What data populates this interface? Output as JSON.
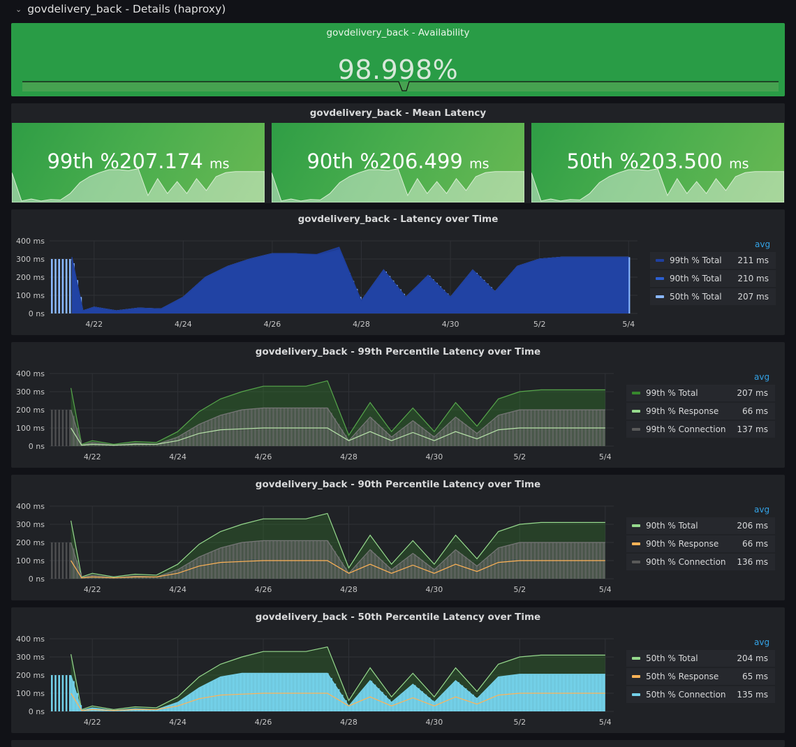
{
  "row": {
    "title": "govdelivery_back - Details (haproxy)"
  },
  "availability": {
    "title": "govdelivery_back - Availability",
    "value": "98.998%"
  },
  "mean_latency": {
    "title": "govdelivery_back - Mean Latency",
    "stats": [
      {
        "label": "99th %",
        "value": "207.174",
        "unit": "ms"
      },
      {
        "label": "90th %",
        "value": "206.499",
        "unit": "ms"
      },
      {
        "label": "50th %",
        "value": "203.500",
        "unit": "ms"
      }
    ]
  },
  "x_ticks": [
    "4/22",
    "4/24",
    "4/26",
    "4/28",
    "4/30",
    "5/2",
    "5/4"
  ],
  "y_ticks": [
    "400 ms",
    "300 ms",
    "200 ms",
    "100 ms",
    "0 ns"
  ],
  "legend_header": "avg",
  "panels": [
    {
      "title": "govdelivery_back - Latency over Time",
      "legend": [
        {
          "name": "99th % Total",
          "value": "211 ms",
          "color": "#1f3f9e"
        },
        {
          "name": "90th % Total",
          "value": "210 ms",
          "color": "#2c5fd1"
        },
        {
          "name": "50th % Total",
          "value": "207 ms",
          "color": "#8ab8ff"
        }
      ]
    },
    {
      "title": "govdelivery_back - 99th Percentile Latency over Time",
      "legend": [
        {
          "name": "99th % Total",
          "value": "207 ms",
          "color": "#37872d"
        },
        {
          "name": "99th % Response",
          "value": "66 ms",
          "color": "#96d98d"
        },
        {
          "name": "99th % Connection",
          "value": "137 ms",
          "color": "#5a5a5a"
        }
      ]
    },
    {
      "title": "govdelivery_back - 90th Percentile Latency over Time",
      "legend": [
        {
          "name": "90th % Total",
          "value": "206 ms",
          "color": "#96d98d"
        },
        {
          "name": "90th % Response",
          "value": "66 ms",
          "color": "#ffb357"
        },
        {
          "name": "90th % Connection",
          "value": "136 ms",
          "color": "#5a5a5a"
        }
      ]
    },
    {
      "title": "govdelivery_back - 50th Percentile Latency over Time",
      "legend": [
        {
          "name": "50th % Total",
          "value": "204 ms",
          "color": "#96d98d"
        },
        {
          "name": "50th % Response",
          "value": "65 ms",
          "color": "#ffb357"
        },
        {
          "name": "50th % Connection",
          "value": "135 ms",
          "color": "#73d0e8"
        }
      ]
    }
  ],
  "chart_data": [
    {
      "type": "area",
      "title": "govdelivery_back - Latency over Time",
      "x": [
        "4/21 12:00",
        "4/21 18:00",
        "4/22 00:00",
        "4/22 12:00",
        "4/23 00:00",
        "4/23 12:00",
        "4/24 00:00",
        "4/24 12:00",
        "4/25 00:00",
        "4/25 12:00",
        "4/26 00:00",
        "4/26 12:00",
        "4/27 00:00",
        "4/27 12:00",
        "4/28 00:00",
        "4/28 12:00",
        "4/29 00:00",
        "4/29 12:00",
        "4/30 00:00",
        "4/30 12:00",
        "5/1 00:00",
        "5/1 12:00",
        "5/2 00:00",
        "5/2 12:00",
        "5/3 00:00",
        "5/3 12:00",
        "5/4 00:00"
      ],
      "series": [
        {
          "name": "99th % Total",
          "values": [
            310,
            15,
            35,
            15,
            30,
            25,
            90,
            200,
            260,
            300,
            330,
            330,
            325,
            365,
            70,
            240,
            90,
            210,
            90,
            240,
            120,
            260,
            300,
            310,
            310,
            310,
            310
          ]
        },
        {
          "name": "90th % Total",
          "values": [
            310,
            15,
            35,
            15,
            30,
            25,
            90,
            200,
            260,
            300,
            330,
            330,
            320,
            350,
            70,
            240,
            90,
            210,
            90,
            240,
            120,
            260,
            300,
            310,
            310,
            310,
            310
          ]
        },
        {
          "name": "50th % Total",
          "values": [
            300,
            15,
            35,
            15,
            30,
            25,
            90,
            200,
            260,
            300,
            330,
            330,
            320,
            340,
            70,
            240,
            90,
            210,
            90,
            240,
            120,
            260,
            300,
            310,
            310,
            310,
            310
          ]
        }
      ],
      "xlim": [
        "4/21",
        "5/4"
      ],
      "ylim": [
        0,
        400
      ],
      "ylabel": ""
    },
    {
      "type": "area",
      "title": "govdelivery_back - 99th Percentile Latency over Time",
      "x": [
        "4/21 12:00",
        "4/21 18:00",
        "4/22 00:00",
        "4/22 12:00",
        "4/23 00:00",
        "4/23 12:00",
        "4/24 00:00",
        "4/24 12:00",
        "4/25 00:00",
        "4/25 12:00",
        "4/26 00:00",
        "4/26 12:00",
        "4/27 00:00",
        "4/27 12:00",
        "4/28 00:00",
        "4/28 12:00",
        "4/29 00:00",
        "4/29 12:00",
        "4/30 00:00",
        "4/30 12:00",
        "5/1 00:00",
        "5/1 12:00",
        "5/2 00:00",
        "5/2 12:00",
        "5/3 00:00",
        "5/3 12:00",
        "5/4 00:00"
      ],
      "series": [
        {
          "name": "99th % Total",
          "values": [
            320,
            10,
            30,
            10,
            25,
            20,
            80,
            190,
            260,
            300,
            330,
            330,
            330,
            360,
            60,
            240,
            80,
            210,
            80,
            240,
            110,
            260,
            300,
            310,
            310,
            310,
            310
          ]
        },
        {
          "name": "99th % Response",
          "values": [
            100,
            5,
            10,
            5,
            10,
            10,
            30,
            70,
            90,
            95,
            100,
            100,
            100,
            100,
            30,
            80,
            30,
            75,
            30,
            80,
            40,
            90,
            100,
            100,
            100,
            100,
            100
          ]
        },
        {
          "name": "99th % Connection",
          "values": [
            200,
            5,
            20,
            5,
            15,
            10,
            50,
            120,
            170,
            200,
            210,
            210,
            210,
            210,
            30,
            160,
            50,
            140,
            50,
            160,
            70,
            170,
            200,
            200,
            200,
            200,
            200
          ]
        }
      ],
      "xlim": [
        "4/21",
        "5/4"
      ],
      "ylim": [
        0,
        400
      ]
    },
    {
      "type": "area",
      "title": "govdelivery_back - 90th Percentile Latency over Time",
      "x": [
        "4/21 12:00",
        "4/21 18:00",
        "4/22 00:00",
        "4/22 12:00",
        "4/23 00:00",
        "4/23 12:00",
        "4/24 00:00",
        "4/24 12:00",
        "4/25 00:00",
        "4/25 12:00",
        "4/26 00:00",
        "4/26 12:00",
        "4/27 00:00",
        "4/27 12:00",
        "4/28 00:00",
        "4/28 12:00",
        "4/29 00:00",
        "4/29 12:00",
        "4/30 00:00",
        "4/30 12:00",
        "5/1 00:00",
        "5/1 12:00",
        "5/2 00:00",
        "5/2 12:00",
        "5/3 00:00",
        "5/3 12:00",
        "5/4 00:00"
      ],
      "series": [
        {
          "name": "90th % Total",
          "values": [
            320,
            10,
            30,
            10,
            25,
            20,
            80,
            190,
            260,
            300,
            330,
            330,
            330,
            360,
            60,
            240,
            80,
            210,
            80,
            240,
            110,
            260,
            300,
            310,
            310,
            310,
            310
          ]
        },
        {
          "name": "90th % Response",
          "values": [
            100,
            5,
            10,
            5,
            10,
            10,
            30,
            70,
            90,
            95,
            100,
            100,
            100,
            100,
            30,
            80,
            30,
            75,
            30,
            80,
            40,
            90,
            100,
            100,
            100,
            100,
            100
          ]
        },
        {
          "name": "90th % Connection",
          "values": [
            200,
            5,
            20,
            5,
            15,
            10,
            50,
            120,
            170,
            200,
            210,
            210,
            210,
            210,
            30,
            160,
            50,
            140,
            50,
            160,
            70,
            170,
            200,
            200,
            200,
            200,
            200
          ]
        }
      ],
      "xlim": [
        "4/21",
        "5/4"
      ],
      "ylim": [
        0,
        400
      ]
    },
    {
      "type": "area",
      "title": "govdelivery_back - 50th Percentile Latency over Time",
      "x": [
        "4/21 12:00",
        "4/21 18:00",
        "4/22 00:00",
        "4/22 12:00",
        "4/23 00:00",
        "4/23 12:00",
        "4/24 00:00",
        "4/24 12:00",
        "4/25 00:00",
        "4/25 12:00",
        "4/26 00:00",
        "4/26 12:00",
        "4/27 00:00",
        "4/27 12:00",
        "4/28 00:00",
        "4/28 12:00",
        "4/29 00:00",
        "4/29 12:00",
        "4/30 00:00",
        "4/30 12:00",
        "5/1 00:00",
        "5/1 12:00",
        "5/2 00:00",
        "5/2 12:00",
        "5/3 00:00",
        "5/3 12:00",
        "5/4 00:00"
      ],
      "series": [
        {
          "name": "50th % Total",
          "values": [
            315,
            10,
            30,
            10,
            25,
            20,
            80,
            190,
            260,
            300,
            330,
            330,
            330,
            355,
            60,
            240,
            80,
            210,
            80,
            240,
            110,
            260,
            300,
            310,
            310,
            310,
            310
          ]
        },
        {
          "name": "50th % Response",
          "values": [
            100,
            5,
            10,
            5,
            10,
            10,
            30,
            70,
            90,
            95,
            100,
            100,
            100,
            100,
            30,
            80,
            30,
            75,
            30,
            80,
            40,
            90,
            100,
            100,
            100,
            100,
            100
          ]
        },
        {
          "name": "50th % Connection",
          "values": [
            200,
            5,
            20,
            5,
            15,
            10,
            50,
            130,
            190,
            210,
            210,
            210,
            210,
            210,
            30,
            170,
            50,
            150,
            50,
            170,
            70,
            190,
            205,
            205,
            205,
            205,
            205
          ]
        }
      ],
      "xlim": [
        "4/21",
        "5/4"
      ],
      "ylim": [
        0,
        400
      ]
    }
  ]
}
